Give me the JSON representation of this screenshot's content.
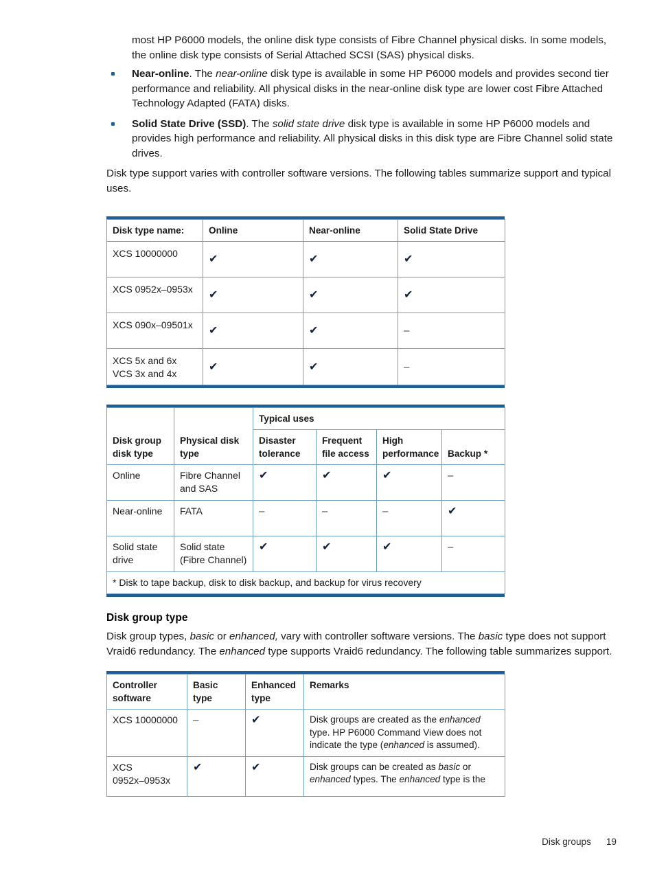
{
  "document": {
    "intro_paragraph_parts": [
      "most HP P6000 models, the online disk type consists of Fibre Channel physical disks. In some models, the online disk type consists of Serial Attached SCSI (SAS) physical disks."
    ],
    "bullets": [
      {
        "lead": "Near-online",
        "rest_1": ". The ",
        "italic_1": "near-online",
        "rest_2": " disk type is available in some HP P6000 models and provides second tier performance and reliability. All physical disks in the near-online disk type are lower cost Fibre Attached Technology Adapted (FATA) disks."
      },
      {
        "lead": "Solid State Drive (SSD)",
        "rest_1": ". The ",
        "italic_1": "solid state drive",
        "rest_2": " disk type is available in some HP P6000 models and provides high performance and reliability. All physical disks in this disk type are Fibre Channel solid state drives."
      }
    ],
    "paragraph_after_bullets": "Disk type support varies with controller software versions. The following tables summarize support and typical uses.",
    "section_heading": "Disk group type",
    "section_paragraph": {
      "t1": "Disk group types, ",
      "i1": "basic",
      "t2": " or ",
      "i2": "enhanced,",
      "t3": " vary with controller software versions. The ",
      "i3": "basic",
      "t4": " type does not support Vraid6 redundancy. The ",
      "i4": "enhanced",
      "t5": " type supports Vraid6 redundancy. The following table summarizes support."
    }
  },
  "glyphs": {
    "check": "✔",
    "dash": "–"
  },
  "colors": {
    "rule": "#1f5e96",
    "cell_border": "#6d9dc5",
    "bullet": "#1f5e96",
    "text": "#1a1a1a"
  },
  "table_disk_type_support": {
    "headers": [
      "Disk type name:",
      "Online",
      "Near-online",
      "Solid State Drive"
    ],
    "rows": [
      {
        "name": "XCS 10000000",
        "online": "✔",
        "near_online": "✔",
        "ssd": "✔"
      },
      {
        "name": "XCS 0952x–0953x",
        "online": "✔",
        "near_online": "✔",
        "ssd": "✔"
      },
      {
        "name": "XCS 090x–09501x",
        "online": "✔",
        "near_online": "✔",
        "ssd": "–"
      },
      {
        "name": "XCS 5x and 6x",
        "name2": "VCS 3x and 4x",
        "online": "✔",
        "near_online": "✔",
        "ssd": "–"
      }
    ]
  },
  "table_typical_uses": {
    "group_header": "Typical uses",
    "headers": {
      "col1_line1": "Disk group",
      "col1_line2": "disk type",
      "col2": "Physical disk type",
      "col3_line1": "Disaster",
      "col3_line2": "tolerance",
      "col4_line1": "Frequent",
      "col4_line2": "file access",
      "col5_line1": "High",
      "col5_line2": "performance",
      "col6": "Backup *"
    },
    "rows": [
      {
        "disk_group_type": "Online",
        "physical_line1": "Fibre Channel",
        "physical_line2": "and SAS",
        "disaster_tolerance": "✔",
        "frequent_file_access": "✔",
        "high_performance": "✔",
        "backup": "–"
      },
      {
        "disk_group_type": "Near-online",
        "physical_line1": "FATA",
        "physical_line2": "",
        "disaster_tolerance": "–",
        "frequent_file_access": "–",
        "high_performance": "–",
        "backup": "✔"
      },
      {
        "disk_group_type": "Solid state",
        "disk_group_type2": "drive",
        "physical_line1": "Solid state",
        "physical_line2": "(Fibre Channel)",
        "disaster_tolerance": "✔",
        "frequent_file_access": "✔",
        "high_performance": "✔",
        "backup": "–"
      }
    ],
    "footnote": "* Disk to tape backup, disk to disk backup, and backup for virus recovery"
  },
  "table_disk_group_type": {
    "headers": {
      "col1_line1": "Controller",
      "col1_line2": "software",
      "col2_line1": "Basic",
      "col2_line2": "type",
      "col3_line1": "Enhanced",
      "col3_line2": "type",
      "col4": "Remarks"
    },
    "rows": [
      {
        "controller_software": "XCS 10000000",
        "controller_software2": "",
        "basic_type": "–",
        "enhanced_type": "✔",
        "remarks": {
          "t1": "Disk groups are created as the ",
          "i1": "enhanced",
          "t2": " type. HP P6000 Command View does not indicate the type (",
          "i2": "enhanced",
          "t3": " is assumed)."
        }
      },
      {
        "controller_software": "XCS",
        "controller_software2": "0952x–0953x",
        "basic_type": "✔",
        "enhanced_type": "✔",
        "remarks": {
          "t1": "Disk groups can be created as ",
          "i1": "basic",
          "t2": " or ",
          "i2": "enhanced",
          "t3": " types. The ",
          "i3": "enhanced",
          "t4": " type is the"
        }
      }
    ]
  },
  "footer": {
    "chapter": "Disk groups",
    "page_number": "19"
  }
}
